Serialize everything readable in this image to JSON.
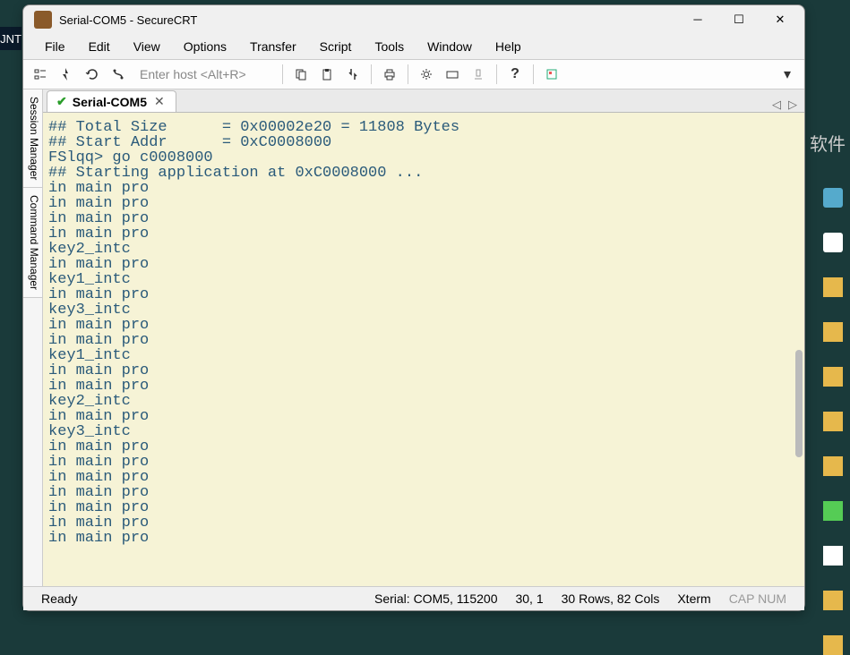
{
  "window": {
    "title": "Serial-COM5 - SecureCRT"
  },
  "menu": {
    "items": [
      "File",
      "Edit",
      "View",
      "Options",
      "Transfer",
      "Script",
      "Tools",
      "Window",
      "Help"
    ]
  },
  "toolbar": {
    "host_placeholder": "Enter host <Alt+R>"
  },
  "leftrail": {
    "tabs": [
      "Session Manager",
      "Command Manager"
    ]
  },
  "tab": {
    "label": "Serial-COM5"
  },
  "terminal": {
    "lines": [
      "## Total Size      = 0x00002e20 = 11808 Bytes",
      "## Start Addr      = 0xC0008000",
      "FSlqq> go c0008000",
      "## Starting application at 0xC0008000 ...",
      "in main pro",
      "in main pro",
      "in main pro",
      "in main pro",
      "key2_intc",
      "in main pro",
      "key1_intc",
      "in main pro",
      "key3_intc",
      "in main pro",
      "in main pro",
      "key1_intc",
      "in main pro",
      "in main pro",
      "key2_intc",
      "in main pro",
      "key3_intc",
      "in main pro",
      "in main pro",
      "in main pro",
      "in main pro",
      "in main pro",
      "in main pro",
      "in main pro"
    ]
  },
  "status": {
    "ready": "Ready",
    "conn": "Serial: COM5, 115200",
    "cursor": "30,  1",
    "size": "30 Rows, 82 Cols",
    "emul": "Xterm",
    "caps": "CAP  NUM"
  },
  "bg": {
    "text1": "软件"
  },
  "left_unt": "JNT"
}
